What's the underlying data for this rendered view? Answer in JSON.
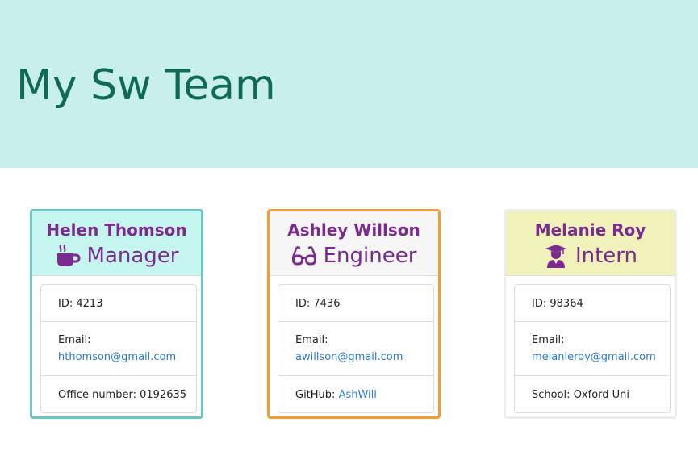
{
  "header": {
    "title": "My Sw Team"
  },
  "employees": [
    {
      "name": "Helen Thomson",
      "role": "Manager",
      "icon": "coffee-mug-icon",
      "id_label": "ID:",
      "id_value": "4213",
      "email_label": "Email:",
      "email": "hthomson@gmail.com",
      "extra_label": "Office number:",
      "extra_value": "0192635"
    },
    {
      "name": "Ashley Willson",
      "role": "Engineer",
      "icon": "glasses-icon",
      "id_label": "ID:",
      "id_value": "7436",
      "email_label": "Email:",
      "email": "awillson@gmail.com",
      "extra_label": "GitHub:",
      "extra_value": "AshWill"
    },
    {
      "name": "Melanie Roy",
      "role": "Intern",
      "icon": "graduate-icon",
      "id_label": "ID:",
      "id_value": "98364",
      "email_label": "Email:",
      "email": "melanieroy@gmail.com",
      "extra_label": "School:",
      "extra_value": "Oxford Uni"
    }
  ],
  "colors": {
    "header_bg": "#c8efea",
    "title": "#0f6a55",
    "accent_text": "#7b2a8f",
    "link": "#2a7bd1",
    "manager_border": "#6cc7c3",
    "manager_header": "#c4f5ef",
    "engineer_border": "#ef9f3a",
    "engineer_header": "#f6f6f6",
    "intern_border": "#ededed",
    "intern_header": "#f1f2b9"
  }
}
